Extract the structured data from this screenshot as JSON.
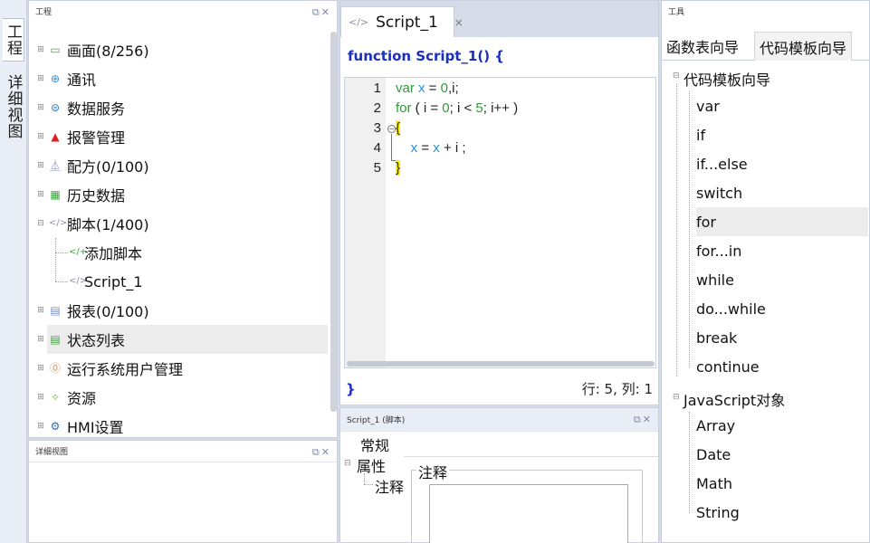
{
  "left_tabs": {
    "project": "工程",
    "detail": "详细视图"
  },
  "project_panel": {
    "title": "工程",
    "tree": [
      {
        "label": "画面(8/256)",
        "icon": "screen-icon"
      },
      {
        "label": "通讯",
        "icon": "globe-icon"
      },
      {
        "label": "数据服务",
        "icon": "data-service-icon"
      },
      {
        "label": "报警管理",
        "icon": "alarm-icon"
      },
      {
        "label": "配方(0/100)",
        "icon": "flask-icon"
      },
      {
        "label": "历史数据",
        "icon": "history-grid-icon"
      },
      {
        "label": "脚本(1/400)",
        "icon": "code-icon"
      },
      {
        "label": "添加脚本",
        "icon": "add-script-icon"
      },
      {
        "label": "Script_1",
        "icon": "code-icon"
      },
      {
        "label": "报表(0/100)",
        "icon": "report-icon"
      },
      {
        "label": "状态列表",
        "icon": "list-doc-icon"
      },
      {
        "label": "运行系统用户管理",
        "icon": "user-manage-icon"
      },
      {
        "label": "资源",
        "icon": "resource-icon"
      },
      {
        "label": "HMI设置",
        "icon": "gear-icon"
      }
    ]
  },
  "detail_panel": {
    "title": "详细视图"
  },
  "editor": {
    "tab_label": "Script_1",
    "tab_close": "×",
    "function_signature": "function Script_1() {",
    "line_numbers": [
      "1",
      "2",
      "3",
      "4",
      "5"
    ],
    "code": {
      "line1": {
        "kw": "var",
        "v1": "x",
        "eq": " = ",
        "n0": "0",
        "rest": ",i;"
      },
      "line2": {
        "kw": "for",
        "p1": " ( i = ",
        "n0": "0",
        "p2": "; i < ",
        "n5": "5",
        "p3": "; i++ )"
      },
      "line3": {
        "brace": "{"
      },
      "line4": {
        "v1": "x",
        "op1": " = ",
        "v2": "x",
        "op2": " + i ;"
      },
      "line5": {
        "brace": "}"
      }
    },
    "closing_brace": "}",
    "cursor_position": "行: 5, 列: 1"
  },
  "properties_panel": {
    "title": "Script_1 (脚本)",
    "tree": {
      "general": "常规",
      "properties": "属性",
      "comment": "注释"
    },
    "group_title": "注释"
  },
  "tools_panel": {
    "title": "工具",
    "tabs": [
      "函数表向导",
      "代码模板向导"
    ],
    "template_group": "代码模板向导",
    "templates": [
      "var",
      "if",
      "if...else",
      "switch",
      "for",
      "for...in",
      "while",
      "do...while",
      "break",
      "continue"
    ],
    "js_group": "JavaScript对象",
    "js_objects": [
      "Array",
      "Date",
      "Math",
      "String"
    ]
  },
  "colors": {
    "keyword": "#2e9b3a",
    "variable": "#2b8fd6",
    "function_header": "#1a2fc0",
    "brace_highlight": "#fff200"
  }
}
